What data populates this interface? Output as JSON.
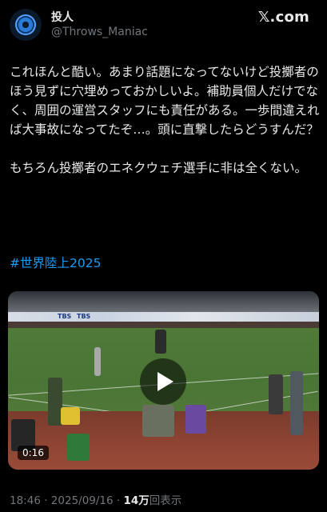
{
  "author": {
    "display_name": "投人",
    "handle": "@Throws_Maniac",
    "avatar_icon": "discus-ring-icon"
  },
  "brand": {
    "logo_text": "𝕏.com"
  },
  "tweet": {
    "text": "これほんと酷い。あまり話題になってないけど投擲者のほう見ずに穴埋めっておかしいよ。補助員個人だけでなく、周囲の運営スタッフにも責任がある。一歩間違えれば大事故になってたぞ…。頭に直撃したらどうすんだ？\n\nもちろん投擲者のエネクウェチ選手に非は全くない。",
    "hashtag": "#世界陸上2025",
    "hashtag_color": "#1d9bf0"
  },
  "media": {
    "type": "video",
    "duration": "0:16",
    "play_icon": "play-icon",
    "banner_text_1": "TBS",
    "banner_text_2": "TBS"
  },
  "meta": {
    "time": "18:46",
    "separator": "·",
    "date": "2025/09/16",
    "views_count": "14万",
    "views_label": "回表示"
  }
}
